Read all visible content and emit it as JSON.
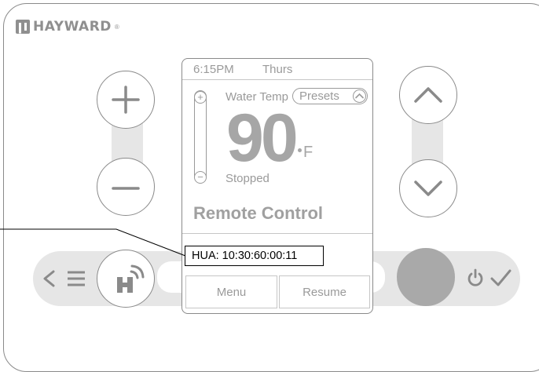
{
  "brand": {
    "name": "HAYWARD",
    "registered": "®"
  },
  "display": {
    "time": "6:15PM",
    "day": "Thurs",
    "temp_label": "Water Temp",
    "presets_label": "Presets",
    "temperature": "90",
    "unit": "F",
    "status": "Stopped",
    "mode": "Remote Control",
    "menu_label": "Menu",
    "resume_label": "Resume"
  },
  "callout": {
    "text": "HUA: 10:30:60:00:11"
  },
  "icons": {
    "plus": "plus-icon",
    "minus": "minus-icon",
    "up": "chevron-up-icon",
    "down": "chevron-down-icon",
    "back": "chevron-left-icon",
    "menu": "hamburger-icon",
    "hayward": "hayward-wifi-icon",
    "power": "power-icon",
    "check": "checkmark-icon"
  },
  "colors": {
    "outline": "#8a8a8a",
    "bar": "#e6e6e6",
    "screen_text": "#9a9a9a",
    "select_button": "#a9a9a9"
  }
}
